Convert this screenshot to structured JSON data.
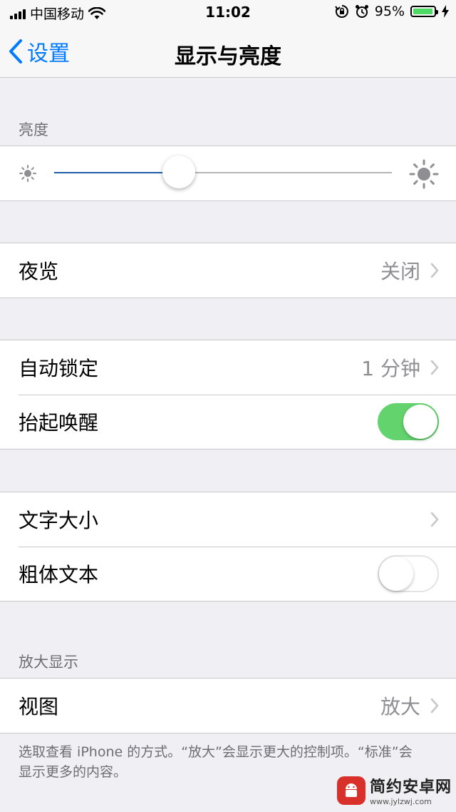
{
  "status_bar": {
    "carrier": "中国移动",
    "time": "11:02",
    "battery_percent": "95%",
    "battery_level": 0.95,
    "icons": [
      "signal-icon",
      "wifi-icon",
      "rotation-lock-icon",
      "alarm-icon",
      "battery-icon",
      "charging-icon"
    ]
  },
  "nav": {
    "back_label": "设置",
    "title": "显示与亮度"
  },
  "brightness": {
    "header": "亮度",
    "level": 0.37
  },
  "night_shift": {
    "label": "夜览",
    "value": "关闭"
  },
  "auto_lock": {
    "label": "自动锁定",
    "value": "1 分钟"
  },
  "raise_to_wake": {
    "label": "抬起唤醒",
    "on": true
  },
  "text_size": {
    "label": "文字大小"
  },
  "bold_text": {
    "label": "粗体文本",
    "on": false
  },
  "zoom": {
    "header": "放大显示",
    "view_label": "视图",
    "view_value": "放大",
    "footer": "选取查看 iPhone 的方式。“放大”会显示更大的控制项。“标准”会显示更多的内容。"
  },
  "watermark": {
    "title": "简约安卓网",
    "url": "www.jylzwj.com"
  },
  "colors": {
    "accent": "#007aff",
    "toggle_on": "#63d36d",
    "battery": "#4cd964"
  }
}
